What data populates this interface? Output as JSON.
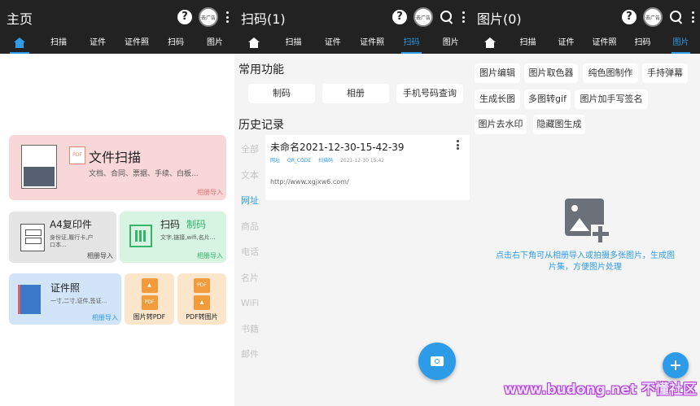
{
  "screen1": {
    "title": "主页",
    "avatar_text": "去广告",
    "tabs": [
      "扫描",
      "证件",
      "证件照",
      "扫码",
      "图片"
    ],
    "active_tab": "home",
    "doc_scan": {
      "title": "文件扫描",
      "subtitle": "文档、合同、票据、手续、白板...",
      "import": "相册导入",
      "pdf_badge": "PDF"
    },
    "a4": {
      "title": "A4复印件",
      "subtitle": "身份证,履行卡,户口本...",
      "import": "相册导入"
    },
    "qr": {
      "title": "扫码",
      "title2": "制码",
      "subtitle": "文字,链接,wifi,名片...",
      "import": "相册导入"
    },
    "id_photo": {
      "title": "证件照",
      "subtitle": "一寸,二寸,证件,签证...",
      "import": "相册导入"
    },
    "img2pdf": {
      "label": "图片转PDF",
      "badge": "PDF"
    },
    "pdf2img": {
      "label": "PDF转图片",
      "badge": "PDF"
    }
  },
  "screen2": {
    "title": "扫码(1)",
    "avatar_text": "去广告",
    "tabs": [
      "扫描",
      "证件",
      "证件照",
      "扫码",
      "图片"
    ],
    "active_tab": "扫码",
    "common_title": "常用功能",
    "common_buttons": [
      "制码",
      "相册",
      "手机号码查询"
    ],
    "history_title": "历史记录",
    "categories": [
      "全部",
      "文本",
      "网址",
      "商品",
      "电话",
      "名片",
      "WiFi",
      "书籍",
      "邮件"
    ],
    "active_category": "网址",
    "history_item": {
      "name": "未命名2021-12-30-15-42-39",
      "tags": [
        "网址",
        "QR_CODE",
        "扫描码"
      ],
      "date": "2021-12-30 15:42",
      "content": "http://www.xgjxw6.com/"
    }
  },
  "screen3": {
    "title": "图片(0)",
    "avatar_text": "去广告",
    "tabs": [
      "扫描",
      "证件",
      "证件照",
      "扫码",
      "图片"
    ],
    "active_tab": "图片",
    "tools": [
      "图片编辑",
      "图片取色器",
      "纯色图制作",
      "手持弹幕",
      "生成长图",
      "多图转gif",
      "图片加手写签名",
      "图片去水印",
      "隐藏图生成"
    ],
    "empty_hint": "点击右下角可从相册导入或拍摄多张图片，生成图片集，方便图片处理"
  },
  "watermark": "www.budong.net 不懂社区",
  "colors": {
    "accent": "#2e9be8",
    "appbar": "#222222",
    "pink": "#f8d7d9",
    "green": "#d7f3e2",
    "blue": "#d2e4f7",
    "orange": "#fbe6cc"
  }
}
